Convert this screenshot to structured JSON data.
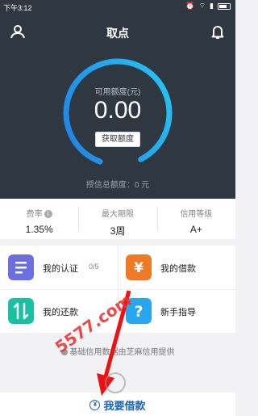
{
  "status_bar": {
    "time": "下午3:12"
  },
  "header": {
    "title": "取点"
  },
  "credit": {
    "available_label": "可用额度(元)",
    "available_value": "0.00",
    "get_limit_button": "获取额度",
    "total_credit": "授信总额度：0 元",
    "ring_colors": [
      "#20b8f0",
      "#1f86e6"
    ]
  },
  "stats": [
    {
      "label": "费率",
      "value": "1.35%"
    },
    {
      "label": "最大期限",
      "value": "3周"
    },
    {
      "label": "信用等级",
      "value": "A+"
    }
  ],
  "menu": {
    "my_auth": {
      "label": "我的认证",
      "count": "0/5",
      "color": "#6d6ee0"
    },
    "my_loan": {
      "label": "我的借款",
      "color": "#f07a24"
    },
    "my_repay": {
      "label": "我的还款",
      "color": "#19c0a1"
    },
    "guide": {
      "label": "新手指导",
      "color": "#28a7f0"
    }
  },
  "provider_text": "基础信用数据由芝麻信用提供",
  "borrow_button": "我要借款",
  "watermark_text": "5577.com"
}
